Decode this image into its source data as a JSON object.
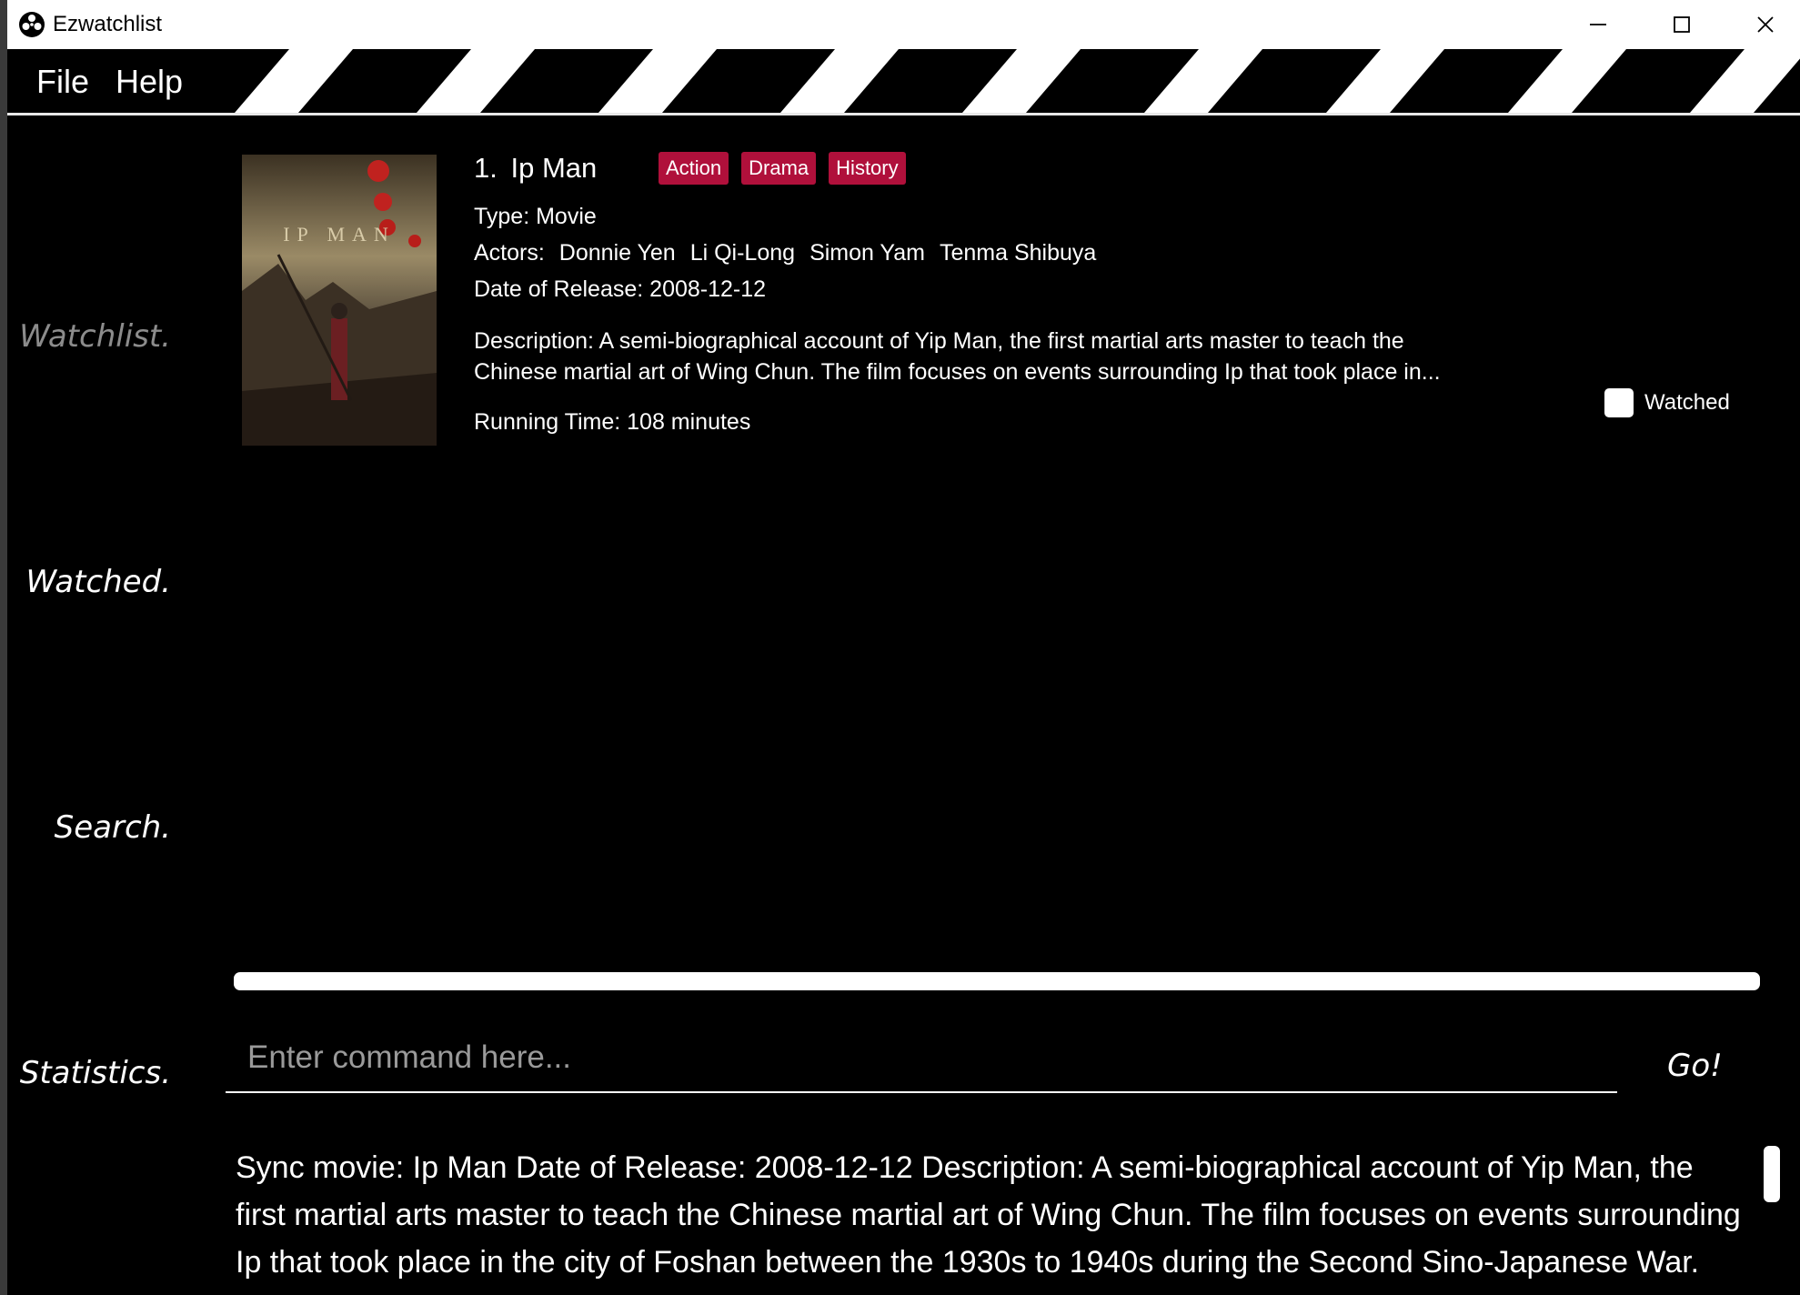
{
  "window": {
    "title": "Ezwatchlist",
    "minimize_icon": "minimize-icon",
    "maximize_icon": "maximize-icon",
    "close_icon": "close-icon"
  },
  "menu": {
    "file": "File",
    "help": "Help"
  },
  "sidebar": {
    "watchlist": "Watchlist.",
    "watched": "Watched.",
    "search": "Search.",
    "statistics": "Statistics."
  },
  "card": {
    "index": "1.",
    "title": "Ip Man",
    "genres": [
      "Action",
      "Drama",
      "History"
    ],
    "type": "Type: Movie",
    "actors_label": "Actors:",
    "actors": [
      "Donnie Yen",
      "Li Qi-Long",
      "Simon Yam",
      "Tenma Shibuya"
    ],
    "date": "Date of Release: 2008-12-12",
    "description": "Description: A semi-biographical account of Yip Man, the first martial arts master to teach the Chinese martial art of Wing Chun. The film focuses on events surrounding Ip that took place in...",
    "running_time": "Running Time: 108 minutes",
    "watched_label": "Watched",
    "watched_checked": false,
    "poster_text": "IP MAN"
  },
  "command": {
    "placeholder": "Enter command here...",
    "go": "Go!"
  },
  "result": {
    "text": "Sync movie: Ip Man Date of Release: 2008-12-12 Description: A semi-biographical account of Yip Man, the first martial arts master to teach the Chinese martial art of Wing Chun. The film focuses on events surrounding Ip that took place in the city of Foshan between the 1930s to 1940s during the Second Sino-Japanese War. Directed by"
  },
  "colors": {
    "background": "#000000",
    "tag": "#b0103b",
    "inactive_nav": "#8c8c8c"
  }
}
